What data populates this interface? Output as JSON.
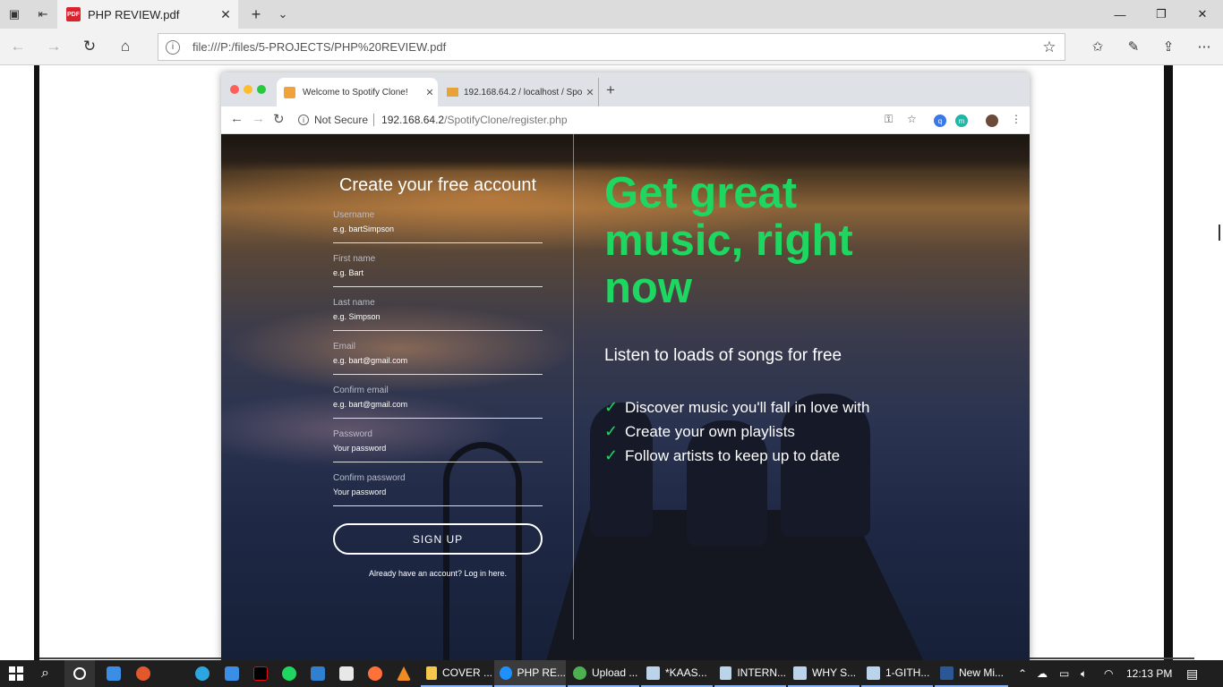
{
  "edge": {
    "tab_title": "PHP REVIEW.pdf",
    "url": "file:///P:/files/5-PROJECTS/PHP%20REVIEW.pdf"
  },
  "embedded_browser": {
    "tab1_title": "Welcome to Spotify Clone!",
    "tab2_title": "192.168.64.2 / localhost / Spot",
    "not_secure": "Not Secure",
    "url_host": "192.168.64.2",
    "url_path": "/SpotifyClone/register.php"
  },
  "register": {
    "heading": "Create your free account",
    "fields": [
      {
        "label": "Username",
        "placeholder": "e.g. bartSimpson"
      },
      {
        "label": "First name",
        "placeholder": "e.g. Bart"
      },
      {
        "label": "Last name",
        "placeholder": "e.g. Simpson"
      },
      {
        "label": "Email",
        "placeholder": "e.g. bart@gmail.com"
      },
      {
        "label": "Confirm email",
        "placeholder": "e.g. bart@gmail.com"
      },
      {
        "label": "Password",
        "placeholder": "Your password"
      },
      {
        "label": "Confirm password",
        "placeholder": "Your password"
      }
    ],
    "signup_label": "SIGN UP",
    "login_link": "Already have an account? Log in here."
  },
  "promo": {
    "headline": "Get great music, right now",
    "subheading": "Listen to loads of songs for free",
    "features": [
      "Discover music you'll fall in love with",
      "Create your own playlists",
      "Follow artists to keep up to date"
    ]
  },
  "taskbar": {
    "apps": [
      "COVER ...",
      "PHP RE...",
      "Upload ...",
      "*KAAS...",
      "INTERN...",
      "WHY S...",
      "1-GITH...",
      "New Mi..."
    ],
    "time": "12:13 PM"
  },
  "colors": {
    "accent_green": "#1ed760",
    "taskbar": "#1f1f1f"
  }
}
